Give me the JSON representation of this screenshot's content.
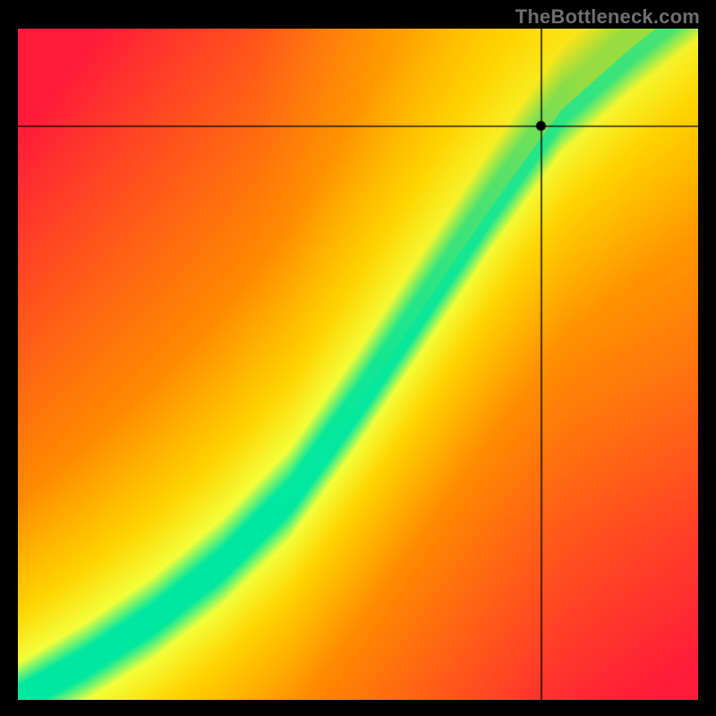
{
  "watermark": "TheBottleneck.com",
  "chart_data": {
    "type": "heatmap",
    "title": "",
    "xlabel": "",
    "ylabel": "",
    "xlim": [
      0,
      1
    ],
    "ylim": [
      0,
      1
    ],
    "marker": {
      "x": 0.77,
      "y": 0.855
    },
    "crosshair": {
      "x": 0.77,
      "y": 0.855
    },
    "ridge_points": [
      {
        "x": 0.0,
        "y": 0.0
      },
      {
        "x": 0.1,
        "y": 0.055
      },
      {
        "x": 0.2,
        "y": 0.12
      },
      {
        "x": 0.3,
        "y": 0.2
      },
      {
        "x": 0.4,
        "y": 0.3
      },
      {
        "x": 0.5,
        "y": 0.44
      },
      {
        "x": 0.6,
        "y": 0.59
      },
      {
        "x": 0.7,
        "y": 0.74
      },
      {
        "x": 0.8,
        "y": 0.88
      },
      {
        "x": 0.9,
        "y": 0.97
      },
      {
        "x": 1.0,
        "y": 1.05
      }
    ],
    "ridge_half_width": 0.038,
    "gradient_corners": {
      "top_left": "#ff1744",
      "top_right": "#ffd600",
      "bottom_left": "#ff1744",
      "bottom_right": "#ff1744"
    },
    "ridge_color": "#00e8a0",
    "near_ridge_color": "#f3ff3b"
  }
}
